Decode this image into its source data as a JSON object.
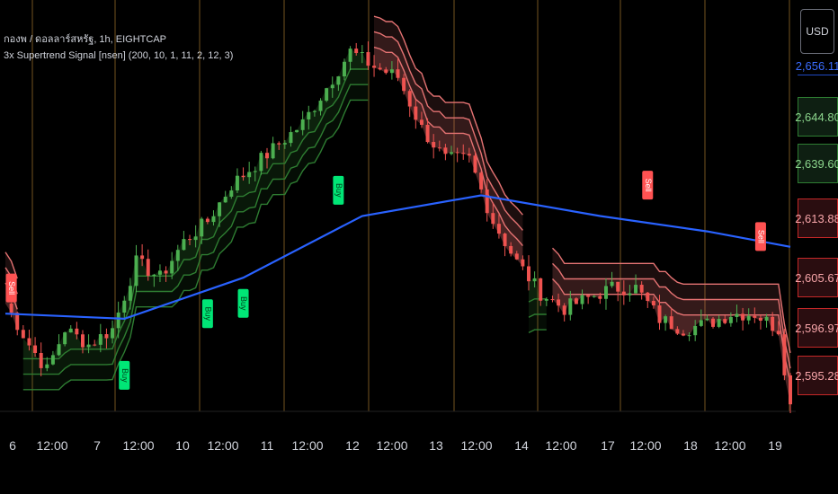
{
  "legend": {
    "symbol_line": "กองพ / ดอลลาร์สหรัฐ, 1h, EIGHTCAP",
    "indicator_line": "3x Supertrend Signal [nsen] (200, 10, 1, 11, 2, 12, 3)"
  },
  "currency_button": "USD",
  "colors": {
    "background": "#000000",
    "up_candle": "#4caf50",
    "down_candle": "#ef5350",
    "supertrend_up": "#2e7d32",
    "supertrend_down": "#e57373",
    "ma_line": "#2962ff",
    "buy_label": "#00e676",
    "sell_label": "#ff5252",
    "session_line": "#3a2a10"
  },
  "price_axis": {
    "labels": [
      "2,656.11",
      "2,644.80",
      "2,639.60",
      "2,613.88",
      "2,605.67",
      "2,596.97",
      "2,595.28"
    ],
    "styles": [
      "blue",
      "green",
      "green",
      "red",
      "red",
      "red",
      "red"
    ]
  },
  "time_axis": {
    "labels": [
      "6",
      "12:00",
      "7",
      "12:00",
      "10",
      "12:00",
      "11",
      "12:00",
      "12",
      "12:00",
      "13",
      "12:00",
      "14",
      "12:00",
      "17",
      "12:00",
      "18",
      "12:00",
      "19"
    ]
  },
  "chart_data": {
    "type": "candlestick",
    "title": "กองพ / ดอลลาร์สหรัฐ, 1h, EIGHTCAP",
    "indicator": "3x Supertrend Signal [nsen] (200, 10, 1, 11, 2, 12, 3)",
    "x_labels": [
      "6",
      "12:00",
      "7",
      "12:00",
      "10",
      "12:00",
      "11",
      "12:00",
      "12",
      "12:00",
      "13",
      "12:00",
      "14",
      "12:00",
      "17",
      "12:00",
      "18",
      "12:00",
      "19"
    ],
    "ylim": [
      2585,
      2665
    ],
    "price_labels": [
      2656.11,
      2644.8,
      2639.6,
      2613.88,
      2605.67,
      2596.97,
      2595.28
    ],
    "close_path": [
      [
        0,
        2606
      ],
      [
        4,
        2598
      ],
      [
        7,
        2593
      ],
      [
        10,
        2601
      ],
      [
        14,
        2598
      ],
      [
        18,
        2601
      ],
      [
        22,
        2614
      ],
      [
        26,
        2611
      ],
      [
        30,
        2618
      ],
      [
        34,
        2622
      ],
      [
        38,
        2629
      ],
      [
        42,
        2633
      ],
      [
        46,
        2637
      ],
      [
        50,
        2641
      ],
      [
        54,
        2648
      ],
      [
        58,
        2655
      ],
      [
        62,
        2652
      ],
      [
        66,
        2650
      ],
      [
        70,
        2640
      ],
      [
        74,
        2634
      ],
      [
        78,
        2634
      ],
      [
        82,
        2622
      ],
      [
        86,
        2614
      ],
      [
        90,
        2608
      ],
      [
        94,
        2605
      ],
      [
        98,
        2607
      ],
      [
        102,
        2609
      ],
      [
        106,
        2609
      ],
      [
        110,
        2603
      ],
      [
        114,
        2601
      ],
      [
        118,
        2602
      ],
      [
        122,
        2604
      ],
      [
        126,
        2604
      ],
      [
        130,
        2601
      ],
      [
        132,
        2586
      ]
    ],
    "ma200": [
      [
        0,
        2604
      ],
      [
        20,
        2603
      ],
      [
        40,
        2611
      ],
      [
        60,
        2623
      ],
      [
        80,
        2627
      ],
      [
        100,
        2623
      ],
      [
        118,
        2620
      ],
      [
        132,
        2617
      ]
    ],
    "signals": [
      {
        "label": "Sell",
        "x": 1,
        "y": 2609
      },
      {
        "label": "Buy",
        "x": 20,
        "y": 2592
      },
      {
        "label": "Buy",
        "x": 34,
        "y": 2604
      },
      {
        "label": "Buy",
        "x": 40,
        "y": 2606
      },
      {
        "label": "Buy",
        "x": 56,
        "y": 2628
      },
      {
        "label": "Sell",
        "x": 108,
        "y": 2629
      },
      {
        "label": "Sell",
        "x": 127,
        "y": 2619
      }
    ]
  }
}
